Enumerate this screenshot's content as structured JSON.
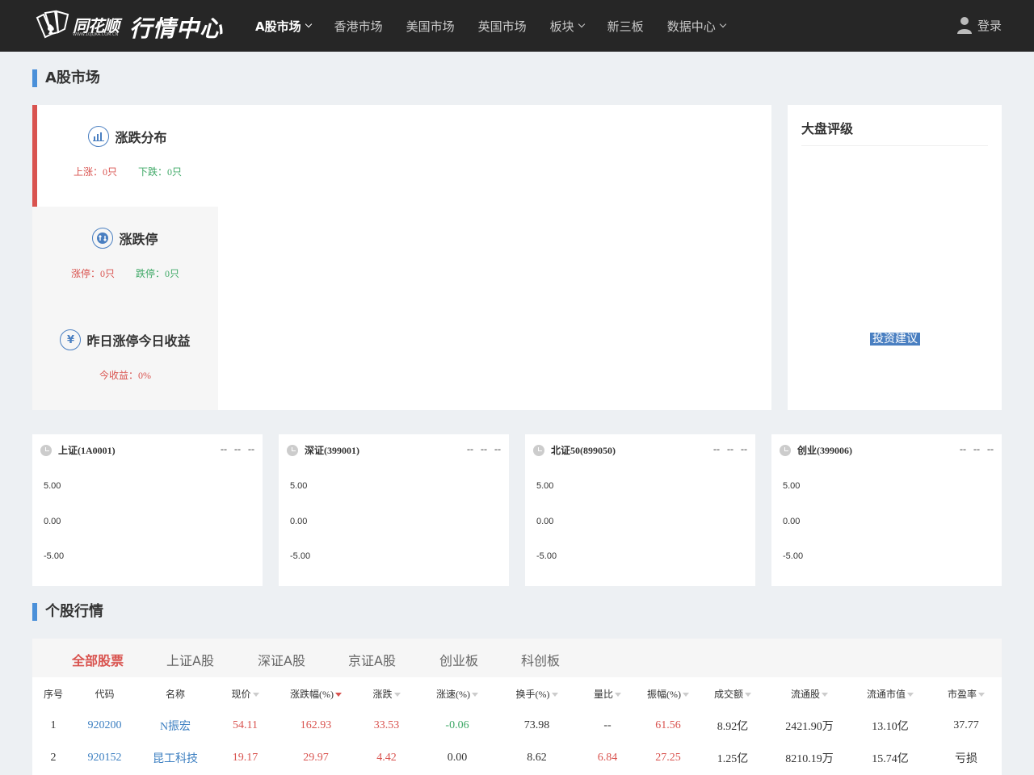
{
  "header": {
    "brand": "同花顺",
    "brand_url": "WWW.10JQKA.COM.CN",
    "site_title": "行情中心",
    "nav": [
      {
        "label": "A股市场",
        "dropdown": true,
        "active": true
      },
      {
        "label": "香港市场",
        "dropdown": false
      },
      {
        "label": "美国市场",
        "dropdown": false
      },
      {
        "label": "英国市场",
        "dropdown": false
      },
      {
        "label": "板块",
        "dropdown": true
      },
      {
        "label": "新三板",
        "dropdown": false
      },
      {
        "label": "数据中心",
        "dropdown": true
      }
    ],
    "login_label": "登录"
  },
  "page": {
    "section_title": "A股市场"
  },
  "overview": {
    "tabs": [
      {
        "title": "涨跌分布",
        "icon": "bar-chart-icon",
        "stats": [
          {
            "text": "上涨：0只",
            "color": "red"
          },
          {
            "text": "下跌：0只",
            "color": "green"
          }
        ],
        "active": true
      },
      {
        "title": "涨跌停",
        "icon": "up-down-arrows-icon",
        "stats": [
          {
            "text": "涨停：0只",
            "color": "red"
          },
          {
            "text": "跌停：0只",
            "color": "green"
          }
        ]
      },
      {
        "title": "昨日涨停今日收益",
        "icon": "yuan-icon",
        "stats": [
          {
            "text": "今收益：0%",
            "color": "red"
          }
        ]
      }
    ]
  },
  "rating": {
    "title": "大盘评级",
    "tag": "投资建议"
  },
  "indices": [
    {
      "name": "上证(1A0001)",
      "values": "-- -- --"
    },
    {
      "name": "深证(399001)",
      "values": "-- -- --"
    },
    {
      "name": "北证50(899050)",
      "values": "-- -- --"
    },
    {
      "name": "创业(399006)",
      "values": "-- -- --"
    }
  ],
  "index_axis": [
    "5.00",
    "0.00",
    "-5.00"
  ],
  "stocks": {
    "section_title": "个股行情",
    "tabs": [
      "全部股票",
      "上证A股",
      "深证A股",
      "京证A股",
      "创业板",
      "科创板"
    ],
    "active_tab": 0,
    "columns": [
      "序号",
      "代码",
      "名称",
      "现价",
      "涨跌幅(%)",
      "涨跌",
      "涨速(%)",
      "换手(%)",
      "量比",
      "振幅(%)",
      "成交额",
      "流通股",
      "流通市值",
      "市盈率"
    ],
    "rows": [
      [
        "1",
        "920200",
        "N振宏",
        "54.11",
        "162.93",
        "33.53",
        "-0.06",
        "73.98",
        "--",
        "61.56",
        "8.92亿",
        "2421.90万",
        "13.10亿",
        "37.77"
      ],
      [
        "2",
        "920152",
        "昆工科技",
        "19.17",
        "29.97",
        "4.42",
        "0.00",
        "8.62",
        "6.84",
        "27.25",
        "1.25亿",
        "8210.19万",
        "15.74亿",
        "亏损"
      ]
    ]
  },
  "colors": {
    "header_bg": "#262626",
    "accent_blue": "#4a90d9",
    "up_red": "#d9534f",
    "down_green": "#3ea866"
  }
}
